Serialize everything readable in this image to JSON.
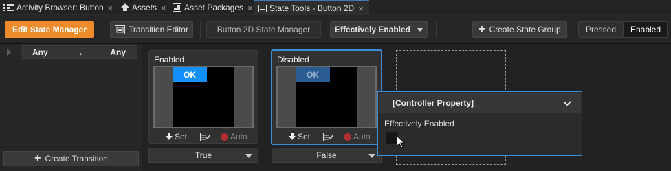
{
  "tabs": [
    {
      "label": "Activity Browser: Button",
      "icon": "activity-browser-icon",
      "active": false
    },
    {
      "label": "Assets",
      "icon": "assets-icon",
      "active": false
    },
    {
      "label": "Asset Packages",
      "icon": "asset-packages-icon",
      "active": false
    },
    {
      "label": "State Tools - Button 2D",
      "icon": "state-tools-icon",
      "active": true
    }
  ],
  "tab_close": "×",
  "toolbar": {
    "edit_state_manager": "Edit State Manager",
    "transition_editor": "Transition Editor",
    "state_manager_name": "Button 2D State Manager",
    "property_dropdown": "Effectively Enabled",
    "create_state_group": "Create State Group",
    "plus": "+",
    "pressed": "Pressed",
    "enabled": "Enabled"
  },
  "left_panel": {
    "from": "Any",
    "arrow": "→",
    "to": "Any",
    "create_transition": "Create Transition"
  },
  "cards": [
    {
      "title": "Enabled",
      "preview_label": "OK",
      "set": "Set",
      "auto": "Auto",
      "value": "True",
      "selected": false
    },
    {
      "title": "Disabled",
      "preview_label": "OK",
      "set": "Set",
      "auto": "Auto",
      "value": "False",
      "selected": true
    }
  ],
  "popup": {
    "header": "[Controller Property]",
    "property_label": "Effectively Enabled",
    "checked": false
  },
  "colors": {
    "accent_orange": "#f08b2c",
    "selection_blue": "#3a8fd8",
    "ok_blue": "#1390ff",
    "auto_red": "#b03030"
  }
}
